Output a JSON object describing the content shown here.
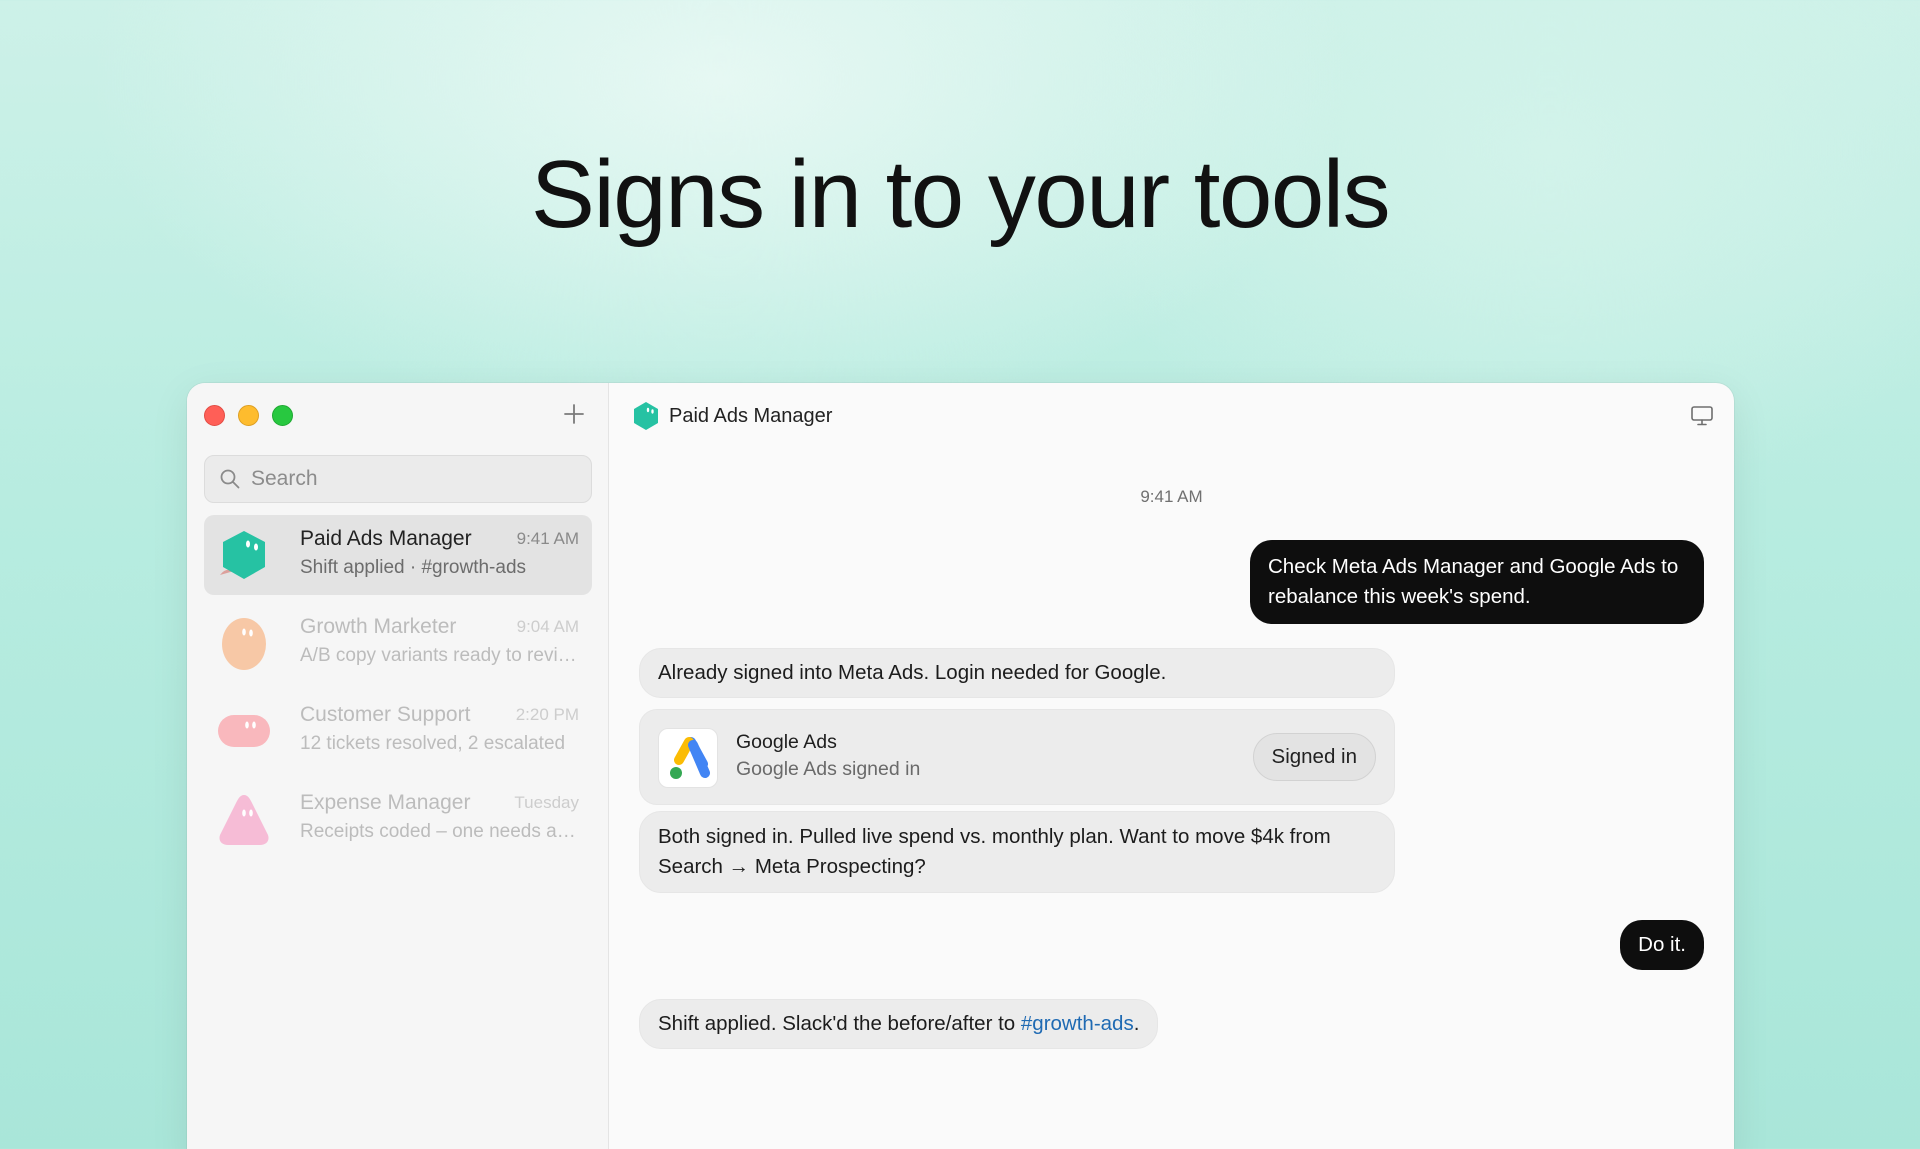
{
  "headline": "Signs in to your tools",
  "sidebar": {
    "search_placeholder": "Search",
    "conversations": [
      {
        "name": "Paid Ads Manager",
        "time": "9:41 AM",
        "preview": "Shift applied · #growth-ads",
        "avatar_color": "#26c2a3"
      },
      {
        "name": "Growth Marketer",
        "time": "9:04 AM",
        "preview": "A/B copy variants ready to review",
        "avatar_color": "#f7c8a6"
      },
      {
        "name": "Customer Support",
        "time": "2:20 PM",
        "preview": "12 tickets resolved, 2 escalated",
        "avatar_color": "#f9b8bd"
      },
      {
        "name": "Expense Manager",
        "time": "Tuesday",
        "preview": "Receipts coded – one needs attention",
        "avatar_color": "#f6bcd6"
      }
    ]
  },
  "chat": {
    "title": "Paid Ads Manager",
    "timestamp": "9:41 AM",
    "messages": {
      "user_1": "Check Meta Ads Manager and Google Ads to rebalance this week's spend.",
      "agent_1": "Already signed into Meta Ads. Login needed for Google.",
      "card_title": "Google Ads",
      "card_subtitle": "Google Ads signed in",
      "card_status": "Signed in",
      "agent_2": "Both signed in. Pulled live spend vs. monthly plan. Want to move $4k from Search → Meta Prospecting?",
      "user_2": "Do it.",
      "reaction": "👍",
      "agent_3_prefix": "Shift applied. Slack'd the before/after to ",
      "agent_3_link": "#growth-ads",
      "agent_3_suffix": "."
    }
  }
}
